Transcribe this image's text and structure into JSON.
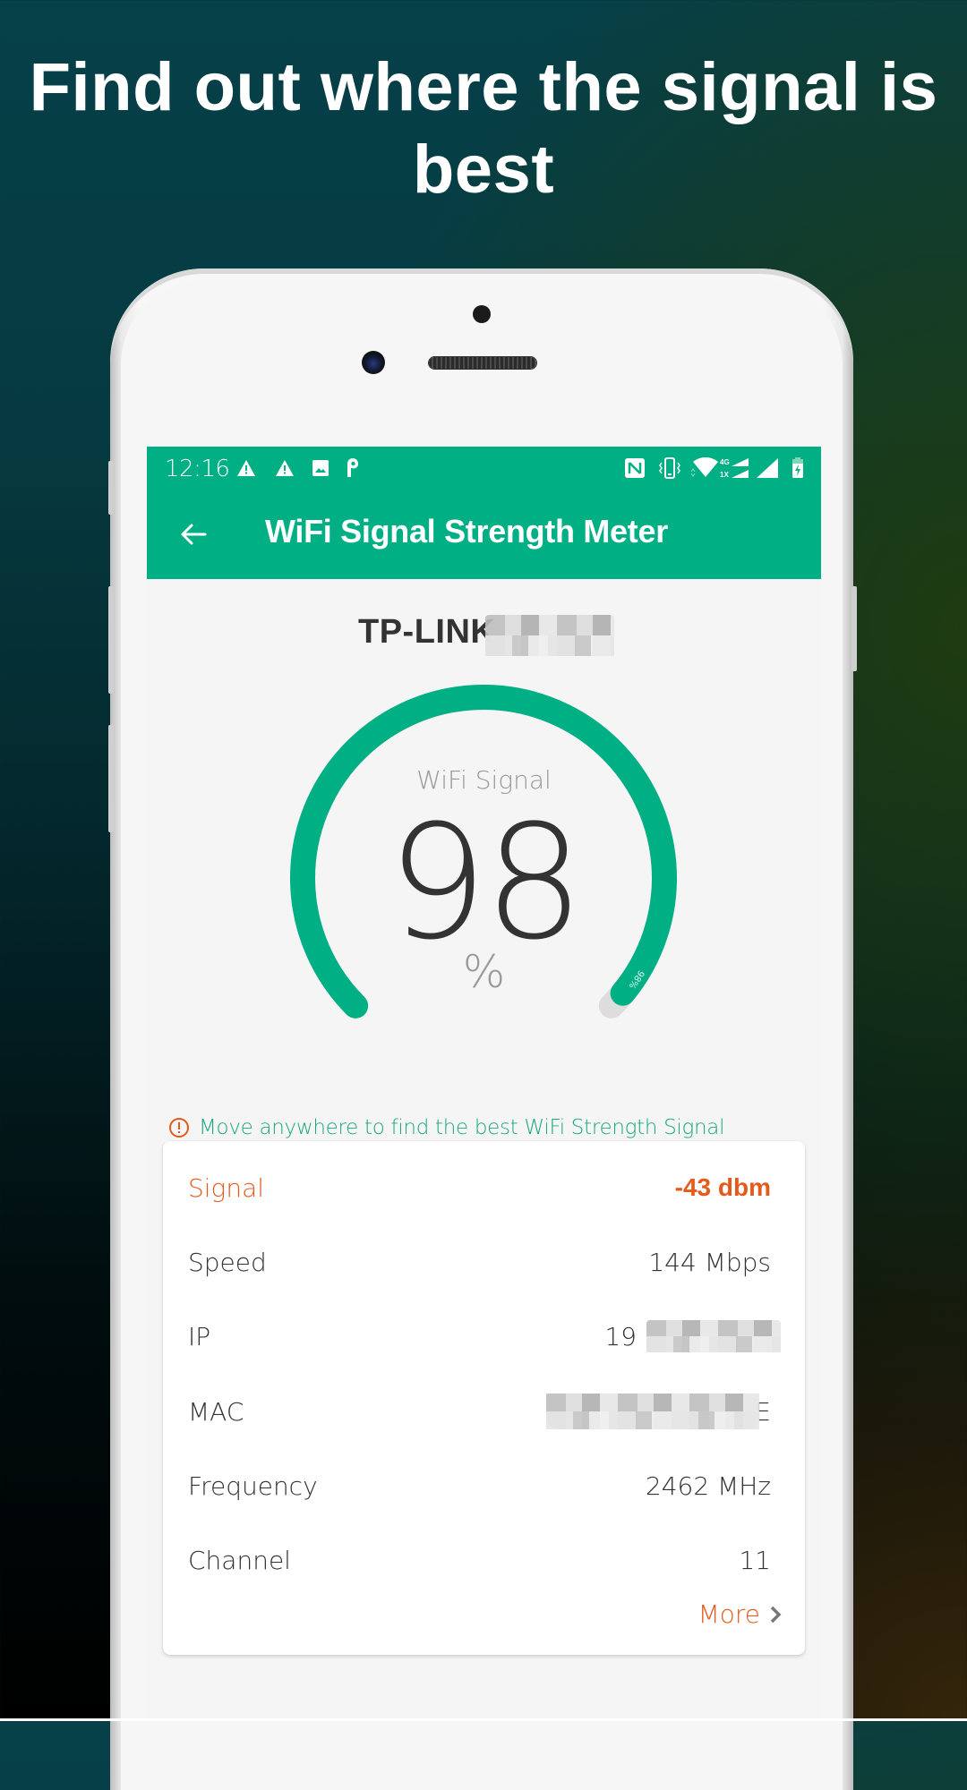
{
  "promo": {
    "headline_line1": "Find out where the signal is",
    "headline_line2": "best"
  },
  "status_bar": {
    "time": "12:16",
    "left_icons": [
      "warning-icon",
      "warning-icon",
      "image-icon",
      "parking-icon"
    ],
    "right_icons": [
      "nfc-icon",
      "vibrate-icon",
      "wifi-icon",
      "signal-4g-1x-icon",
      "cell-signal-icon",
      "battery-charging-icon"
    ],
    "network_labels": {
      "top": "4G",
      "bottom": "1X"
    }
  },
  "appbar": {
    "title": "WiFi Signal Strength Meter",
    "back_icon": "arrow-left-icon"
  },
  "network": {
    "ssid_visible": "TP-LINK",
    "ssid_obscured": true
  },
  "gauge": {
    "label": "WiFi Signal",
    "value": "98",
    "unit": "%",
    "progress_percent": 98,
    "arc_label": "98%"
  },
  "hint": {
    "icon": "alert-circle-icon",
    "text": "Move anywhere to find the best WiFi Strength Signal"
  },
  "details": {
    "rows": [
      {
        "key": "Signal",
        "value": "-43 dbm",
        "highlight": true
      },
      {
        "key": "Speed",
        "value": "144 Mbps"
      },
      {
        "key": "IP",
        "value": "19",
        "obscured": true
      },
      {
        "key": "MAC",
        "value": "E",
        "obscured": true
      },
      {
        "key": "Frequency",
        "value": "2462 MHz"
      },
      {
        "key": "Channel",
        "value": "11"
      }
    ],
    "more_label": "More",
    "more_icon": "chevron-right-icon"
  },
  "colors": {
    "primary": "#00b084",
    "accent": "#e45a1c",
    "gauge_track": "#dddddd",
    "text_dark": "#333333",
    "text_muted": "#999999"
  }
}
